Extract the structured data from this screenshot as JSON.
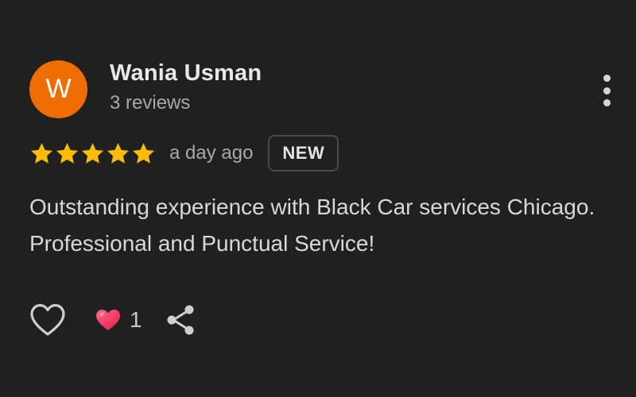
{
  "review": {
    "author": {
      "initial": "W",
      "name": "Wania Usman",
      "reviews": "3 reviews",
      "avatar_color": "#ef6c00"
    },
    "rating": 5,
    "rating_max": 5,
    "star_color": "#fbbc04",
    "time_ago": "a day ago",
    "badge": "NEW",
    "text": "Outstanding experience with Black Car services Chicago. Professional and Punctual Service!",
    "actions": {
      "like_icon": "heart-outline-icon",
      "reaction_icon": "heart-filled-icon",
      "reaction_count": "1",
      "share_icon": "share-icon"
    },
    "menu_icon": "more-vertical-icon"
  }
}
